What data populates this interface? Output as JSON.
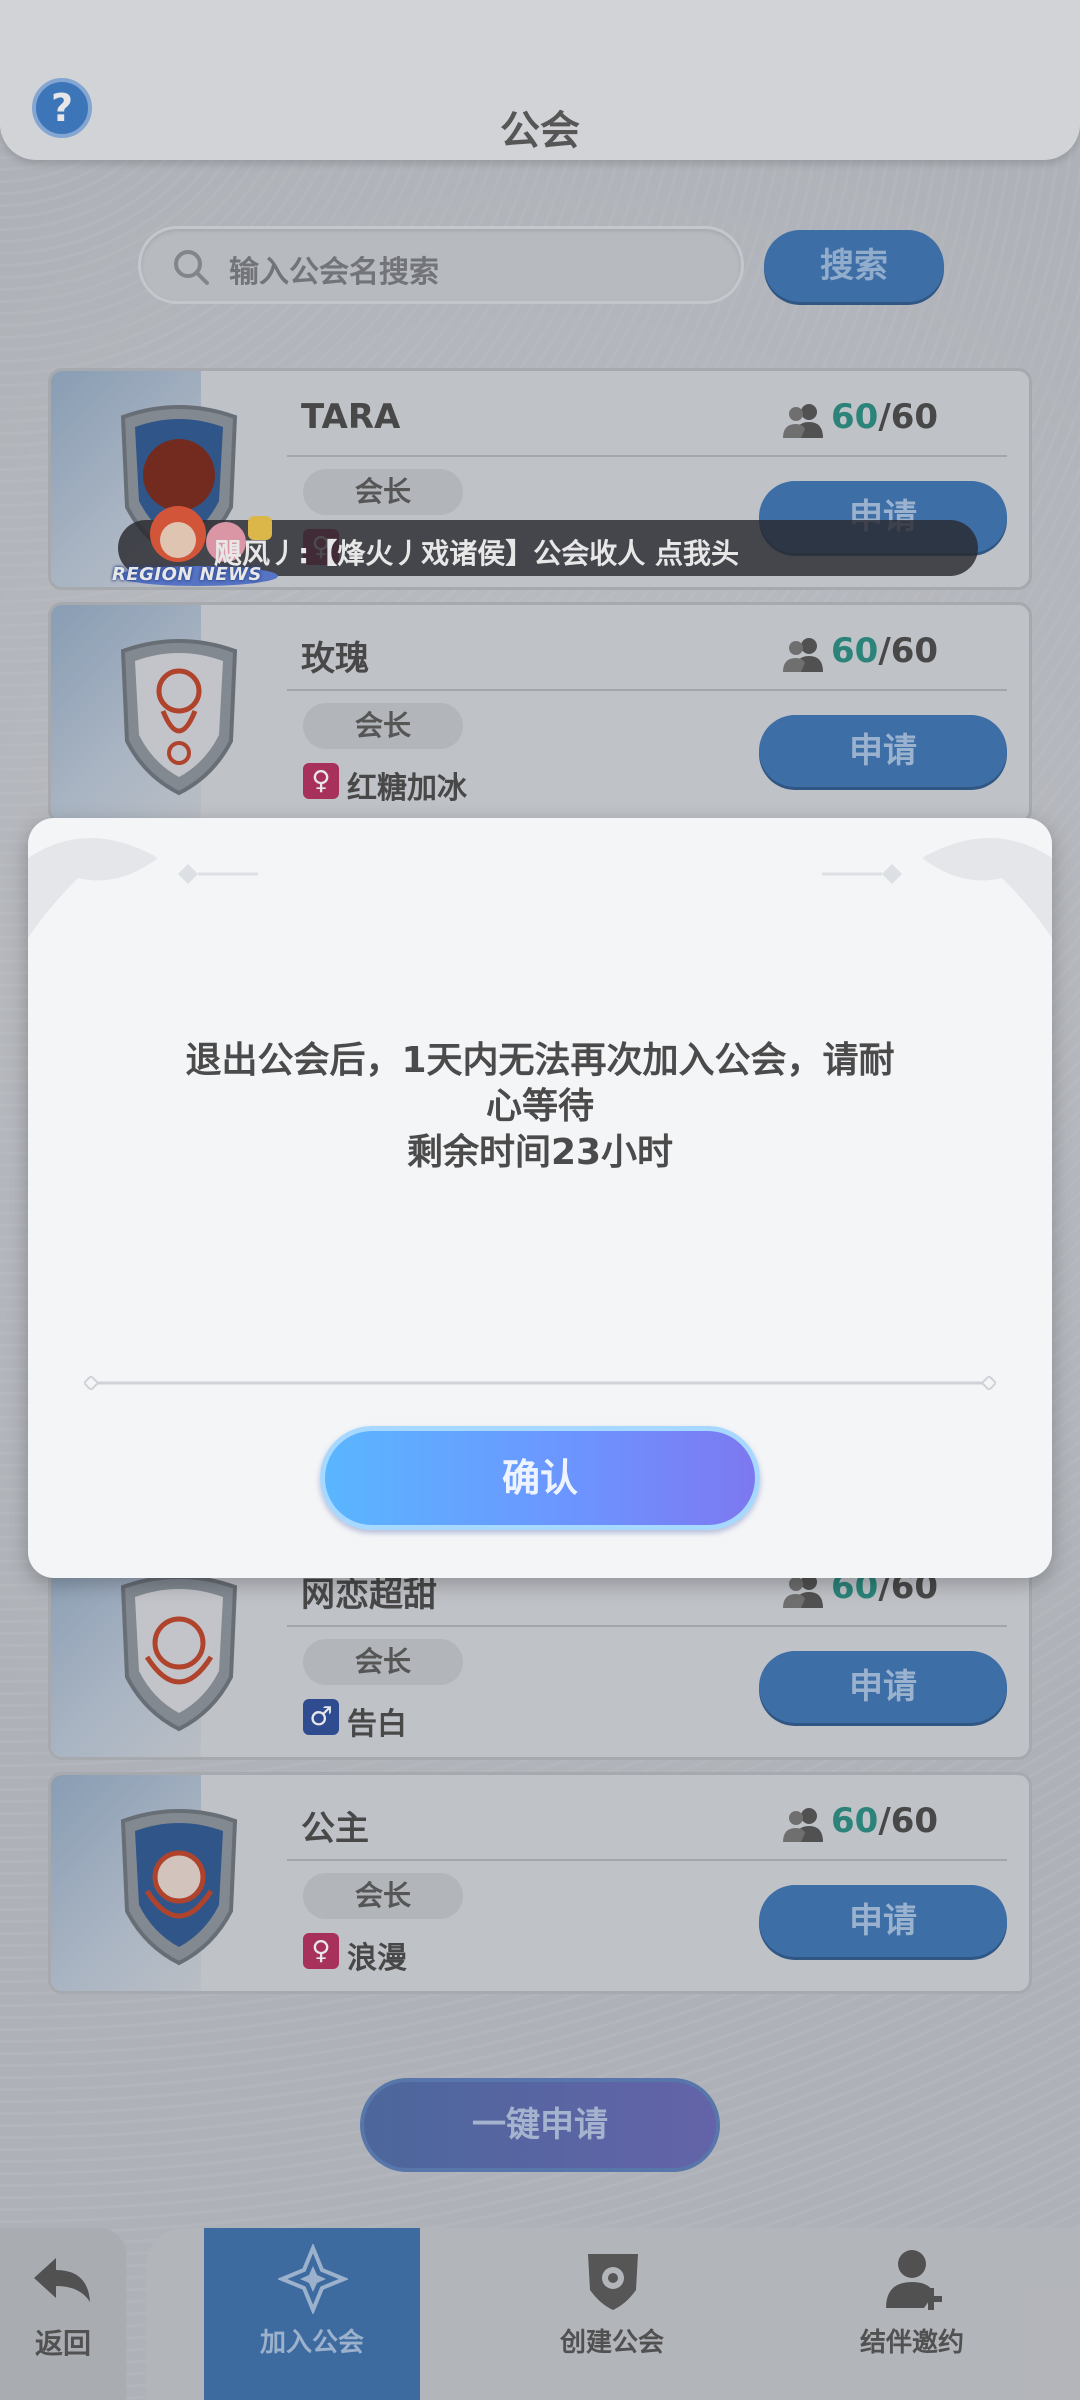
{
  "header": {
    "title": "公会",
    "help_icon": "?"
  },
  "search": {
    "placeholder": "输入公会名搜索",
    "button_label": "搜索"
  },
  "guilds": [
    {
      "name": "TARA",
      "members_current": "60",
      "members_max": "60",
      "role": "会长",
      "leader": "",
      "gender": "female",
      "apply_label": "申请",
      "emblem": "tree-emblem"
    },
    {
      "name": "玫瑰",
      "members_current": "60",
      "members_max": "60",
      "role": "会长",
      "leader": "红糖加冰",
      "gender": "female",
      "apply_label": "申请",
      "emblem": "cat-emblem"
    },
    {
      "name": "网恋超甜",
      "members_current": "60",
      "members_max": "60",
      "role": "会长",
      "leader": "告白",
      "gender": "male",
      "apply_label": "申请",
      "emblem": "poring-emblem"
    },
    {
      "name": "公主",
      "members_current": "60",
      "members_max": "60",
      "role": "会长",
      "leader": "浪漫",
      "gender": "female",
      "apply_label": "申请",
      "emblem": "poring-emblem"
    }
  ],
  "news": {
    "badge_label": "REGION NEWS",
    "text": "飓风丿:【烽火丿戏诸侯】公会收人 点我头"
  },
  "one_click": {
    "label": "一键申请"
  },
  "bottom_nav": {
    "back_label": "返回",
    "tabs": [
      {
        "label": "加入公会",
        "active": true
      },
      {
        "label": "创建公会",
        "active": false
      },
      {
        "label": "结伴邀约",
        "active": false
      }
    ]
  },
  "dialog": {
    "message_line1": "退出公会后，1天内无法再次加入公会，请耐",
    "message_line2": "心等待",
    "message_line3": "剩余时间23小时",
    "confirm_label": "确认"
  },
  "colors": {
    "accent_blue": "#3e76b4",
    "member_count_green": "#2a8e82",
    "female": "#b83060",
    "male": "#2e4f9c"
  }
}
